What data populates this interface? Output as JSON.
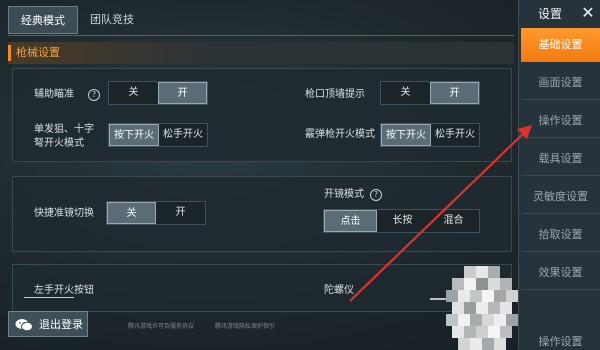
{
  "tabs": [
    {
      "label": "经典模式",
      "active": true
    },
    {
      "label": "团队竞技",
      "active": false
    }
  ],
  "sidebar": {
    "title": "设置",
    "close": "✕",
    "items": [
      {
        "label": "基础设置",
        "active": true
      },
      {
        "label": "画面设置",
        "active": false
      },
      {
        "label": "操作设置",
        "active": false
      },
      {
        "label": "载具设置",
        "active": false
      },
      {
        "label": "灵敏度设置",
        "active": false
      },
      {
        "label": "拾取设置",
        "active": false
      },
      {
        "label": "效果设置",
        "active": false
      },
      {
        "label": "操作设置",
        "active": false
      }
    ]
  },
  "section": {
    "title": "枪械设置"
  },
  "settings": {
    "aim_assist": {
      "label": "辅助瞄准",
      "help": "?",
      "options": [
        "关",
        "开"
      ],
      "selected": "开"
    },
    "wall_hint": {
      "label": "枪口顶墙提示",
      "options": [
        "关",
        "开"
      ],
      "selected": "开"
    },
    "single_fire": {
      "label1": "单发狙、十字",
      "label2": "弩开火模式",
      "options": [
        "按下开火",
        "松手开火"
      ],
      "selected": "按下开火"
    },
    "shotgun_fire": {
      "label": "霰弹枪开火模式",
      "options": [
        "按下开火",
        "松手开火"
      ],
      "selected": "按下开火"
    },
    "quick_scope": {
      "label": "快捷准镜切换",
      "options": [
        "关",
        "开"
      ],
      "selected": "关"
    },
    "scope_mode": {
      "label": "开镜模式",
      "help": "?",
      "options": [
        "点击",
        "长按",
        "混合"
      ],
      "selected": "点击"
    },
    "left_fire": {
      "label": "左手开火按钮"
    },
    "gyro": {
      "label": "陀螺仪"
    }
  },
  "logout": {
    "label": "退出登录",
    "icon": "wechat-icon"
  },
  "footer": {
    "link1": "腾讯游戏许可及服务协议",
    "link2": "腾讯游戏隐私保护指引"
  },
  "colors": {
    "accent": "#f28a1e",
    "annotation": "#e0322a"
  }
}
